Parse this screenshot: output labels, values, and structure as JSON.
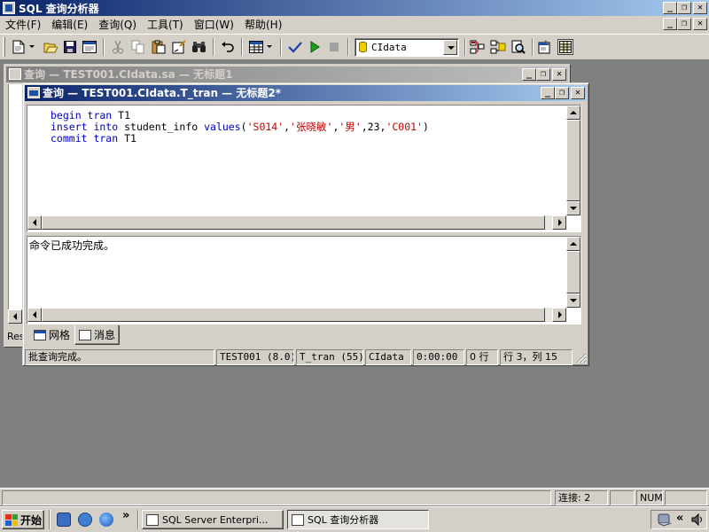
{
  "app": {
    "title": "SQL 查询分析器",
    "caption_buttons": [
      "_",
      "❐",
      "✕"
    ]
  },
  "menu": {
    "items": [
      "文件(F)",
      "编辑(E)",
      "查询(Q)",
      "工具(T)",
      "窗口(W)",
      "帮助(H)"
    ],
    "mdi_buttons": [
      "_",
      "❐",
      "✕"
    ]
  },
  "toolbar": {
    "database": "CIdata",
    "icons": [
      "new-query-icon",
      "open-icon",
      "save-icon",
      "load-sql-icon",
      "cut-icon",
      "copy-icon",
      "paste-icon",
      "clear-window-icon",
      "find-icon",
      "undo-icon",
      "results-grid-icon",
      "parse-query-icon",
      "execute-icon",
      "cancel-execution-icon",
      "object-browser-icon",
      "object-search-icon",
      "show-plan-icon",
      "properties-icon",
      "show-results-pane-icon"
    ]
  },
  "window_back": {
    "title": "查询 — TEST001.CIdata.sa — 无标题1",
    "clipped_label": "Res"
  },
  "window_front": {
    "title": "查询 — TEST001.CIdata.T_tran — 无标题2*",
    "code_lines": [
      [
        {
          "t": "begin tran",
          "c": "kw"
        },
        {
          "t": " T1",
          "c": ""
        }
      ],
      [
        {
          "t": "insert into",
          "c": "kw"
        },
        {
          "t": " student_info ",
          "c": ""
        },
        {
          "t": "values",
          "c": "kw"
        },
        {
          "t": "(",
          "c": ""
        },
        {
          "t": "'S014'",
          "c": "str"
        },
        {
          "t": ",",
          "c": ""
        },
        {
          "t": "'张晓敏'",
          "c": "str"
        },
        {
          "t": ",",
          "c": ""
        },
        {
          "t": "'男'",
          "c": "str"
        },
        {
          "t": ",23,",
          "c": ""
        },
        {
          "t": "'C001'",
          "c": "str"
        },
        {
          "t": ")",
          "c": ""
        }
      ],
      [
        {
          "t": "commit tran",
          "c": "kw"
        },
        {
          "t": " T1",
          "c": ""
        }
      ]
    ],
    "message": "命令已成功完成。",
    "tabs": {
      "grid": "网格",
      "messages": "消息"
    },
    "status": {
      "text": "批查询完成。",
      "server": "TEST001 (8.0)",
      "user": "T_tran (55)",
      "database": "CIdata",
      "elapsed": "0:00:00",
      "rows": "0 行",
      "position": "行 3，列 15"
    }
  },
  "app_status": {
    "connections": "连接: 2",
    "num": "NUM"
  },
  "taskbar": {
    "start": "开始",
    "tasks": [
      "SQL Server Enterpri...",
      "SQL 查询分析器"
    ],
    "chevron": "»",
    "tray_chevron": "«"
  }
}
